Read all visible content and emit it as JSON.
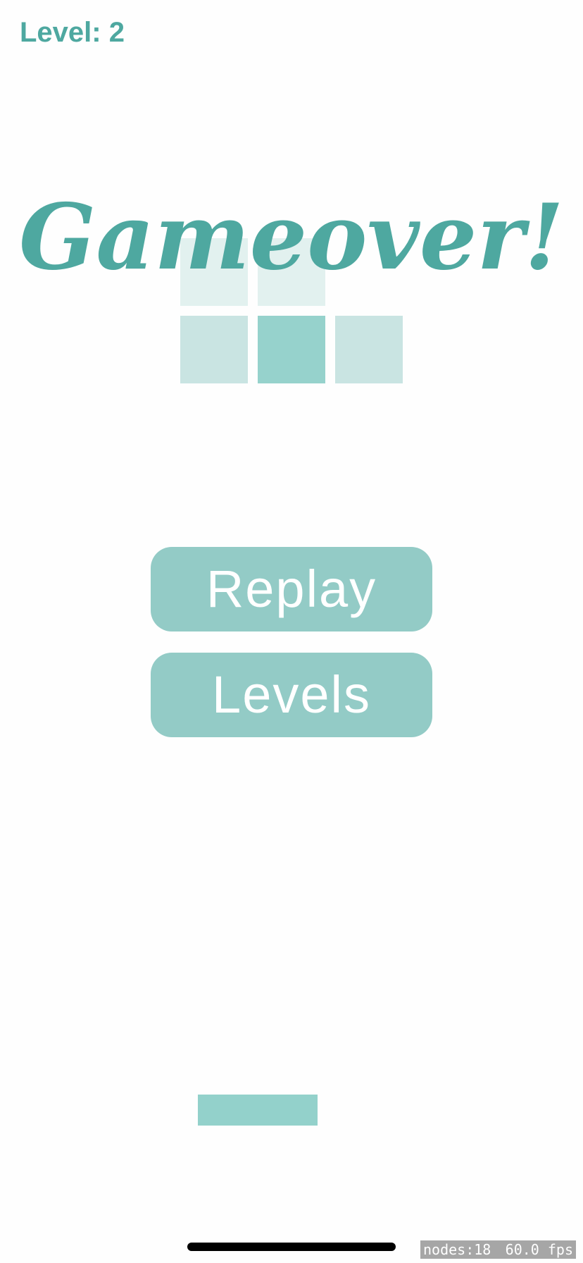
{
  "hud": {
    "level_label": "Level: 2"
  },
  "gameover": {
    "title": "Gameover!"
  },
  "buttons": {
    "replay_label": "Replay",
    "levels_label": "Levels"
  },
  "debug": {
    "nodes": "nodes:18",
    "fps": "60.0 fps"
  },
  "colors": {
    "accent": "#4ea8a0",
    "button": "#93cbc6",
    "block_dark": "#96d2cc",
    "block_mid": "#c9e4e2",
    "block_light": "#e2f1ef",
    "background": "#fefefe"
  }
}
